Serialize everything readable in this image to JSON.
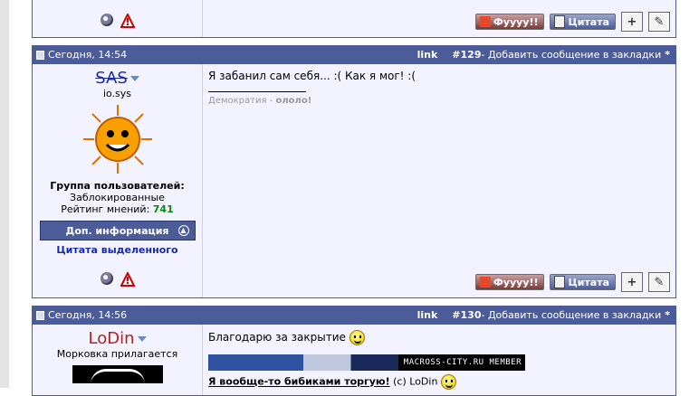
{
  "post_top": {
    "buttons": {
      "fu": "Фуууу!!",
      "quote": "Цитата"
    }
  },
  "post129": {
    "date": "Сегодня, 14:54",
    "link": "link",
    "number": "#129",
    "bookmark": "- Добавить сообщение в закладки",
    "star": "*",
    "user": {
      "nick": "SAS",
      "title": "io.sys",
      "group_label": "Группа пользователей:",
      "group": "Заблокированные",
      "rating_label": "Рейтинг мнений:",
      "rating": "741",
      "more_info": "Доп. информация",
      "quote_selected": "Цитата выделенного"
    },
    "message": "Я забанил сам себя... :( Как я мог! :(",
    "signature": {
      "prefix": "Демократия -",
      "bold": "ололо!"
    },
    "buttons": {
      "fu": "Фуууу!!",
      "quote": "Цитата"
    }
  },
  "post130": {
    "date": "Сегодня, 14:56",
    "link": "link",
    "number": "#130",
    "bookmark": "- Добавить сообщение в закладки",
    "star": "*",
    "user": {
      "nick": "LoDin",
      "title": "Морковка прилагается"
    },
    "message": "Благодарю за закрытие",
    "banner_text": "MACROSS-CITY.RU MEMBER",
    "quote_bold": "Я вообще-то бибиками торгую!",
    "quote_rest": "(c) LoDin"
  },
  "colors": {
    "header": "#4c5c98",
    "body": "#f3f3ff",
    "rating": "#0a8a0a"
  }
}
